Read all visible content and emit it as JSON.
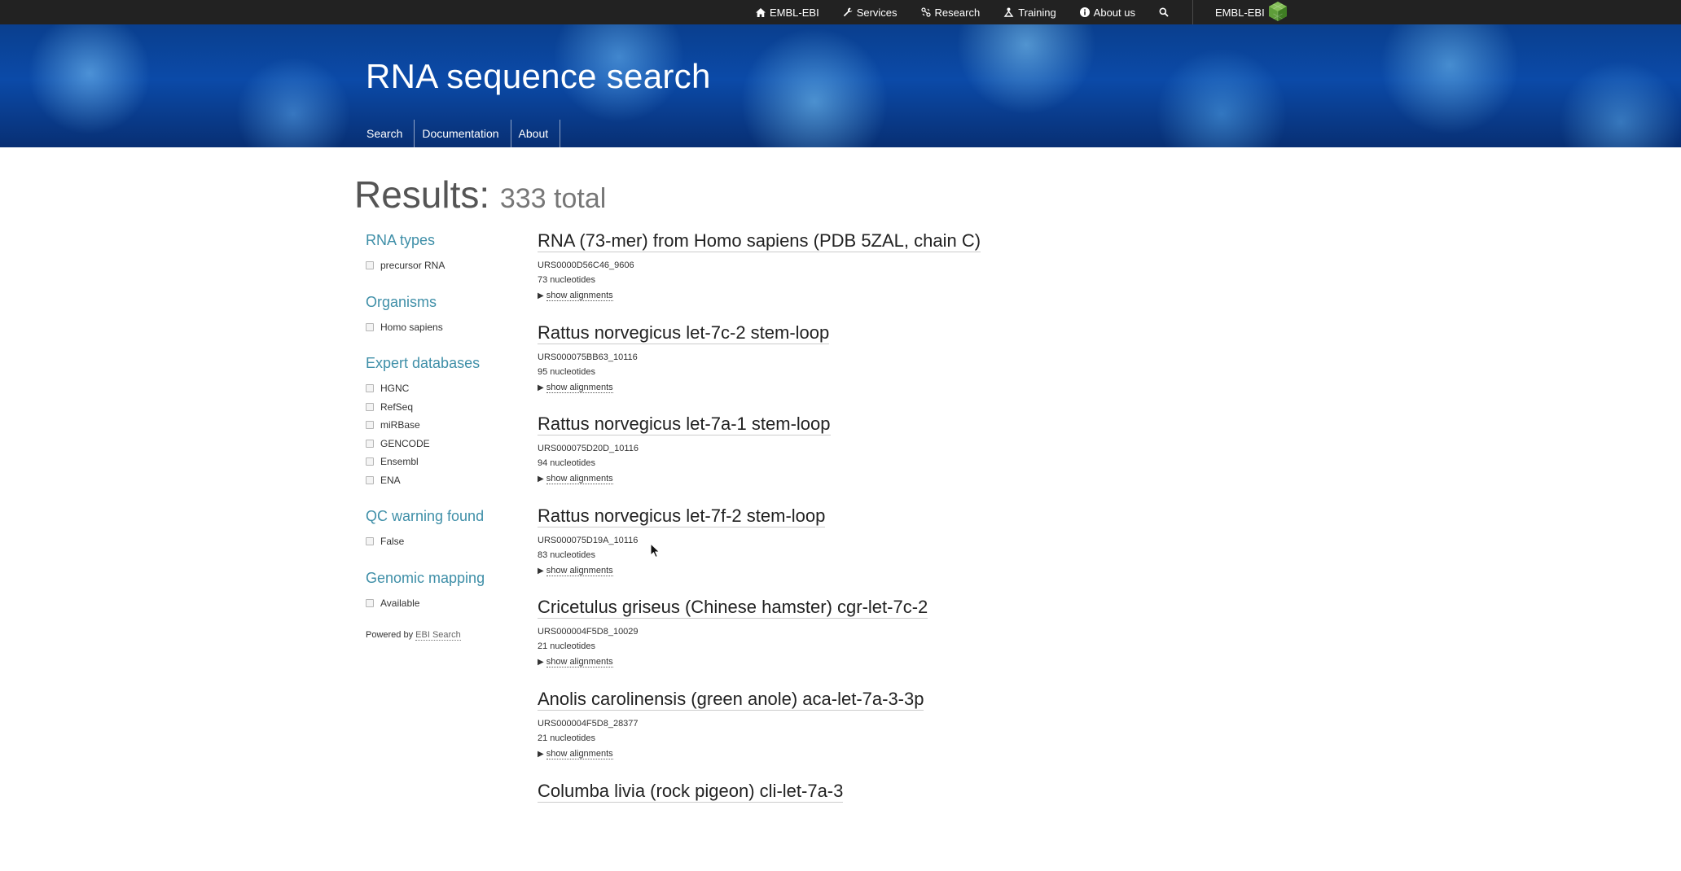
{
  "topnav": {
    "items": [
      {
        "label": "EMBL-EBI",
        "icon": "home-icon"
      },
      {
        "label": "Services",
        "icon": "wrench-icon"
      },
      {
        "label": "Research",
        "icon": "research-icon"
      },
      {
        "label": "Training",
        "icon": "training-icon"
      },
      {
        "label": "About us",
        "icon": "info-icon"
      }
    ],
    "search_icon": "search-icon",
    "brand_label": "EMBL-EBI",
    "brand_icon": "embl-ebi-logo-icon"
  },
  "hero": {
    "title": "RNA sequence search",
    "tabs": [
      "Search",
      "Documentation",
      "About"
    ]
  },
  "results_header": {
    "label": "Results:",
    "total": "333 total"
  },
  "facets": [
    {
      "title": "RNA types",
      "options": [
        "precursor RNA"
      ]
    },
    {
      "title": "Organisms",
      "options": [
        "Homo sapiens"
      ]
    },
    {
      "title": "Expert databases",
      "options": [
        "HGNC",
        "RefSeq",
        "miRBase",
        "GENCODE",
        "Ensembl",
        "ENA"
      ]
    },
    {
      "title": "QC warning found",
      "options": [
        "False"
      ]
    },
    {
      "title": "Genomic mapping",
      "options": [
        "Available"
      ]
    }
  ],
  "powered_by": {
    "prefix": "Powered by",
    "link": "EBI Search"
  },
  "results": [
    {
      "title": "RNA (73-mer) from Homo sapiens (PDB 5ZAL, chain C)",
      "id": "URS0000D56C46_9606",
      "length": "73 nucleotides",
      "action": "show alignments"
    },
    {
      "title": "Rattus norvegicus let-7c-2 stem-loop",
      "id": "URS000075BB63_10116",
      "length": "95 nucleotides",
      "action": "show alignments"
    },
    {
      "title": "Rattus norvegicus let-7a-1 stem-loop",
      "id": "URS000075D20D_10116",
      "length": "94 nucleotides",
      "action": "show alignments"
    },
    {
      "title": "Rattus norvegicus let-7f-2 stem-loop",
      "id": "URS000075D19A_10116",
      "length": "83 nucleotides",
      "action": "show alignments"
    },
    {
      "title": "Cricetulus griseus (Chinese hamster) cgr-let-7c-2",
      "id": "URS000004F5D8_10029",
      "length": "21 nucleotides",
      "action": "show alignments"
    },
    {
      "title": "Anolis carolinensis (green anole) aca-let-7a-3-3p",
      "id": "URS000004F5D8_28377",
      "length": "21 nucleotides",
      "action": "show alignments"
    },
    {
      "title": "Columba livia (rock pigeon) cli-let-7a-3",
      "id": "",
      "length": "",
      "action": ""
    }
  ],
  "colors": {
    "topbar": "#222222",
    "facet_title": "#3f8fa8",
    "hero_blue": "#0b4aa8"
  }
}
